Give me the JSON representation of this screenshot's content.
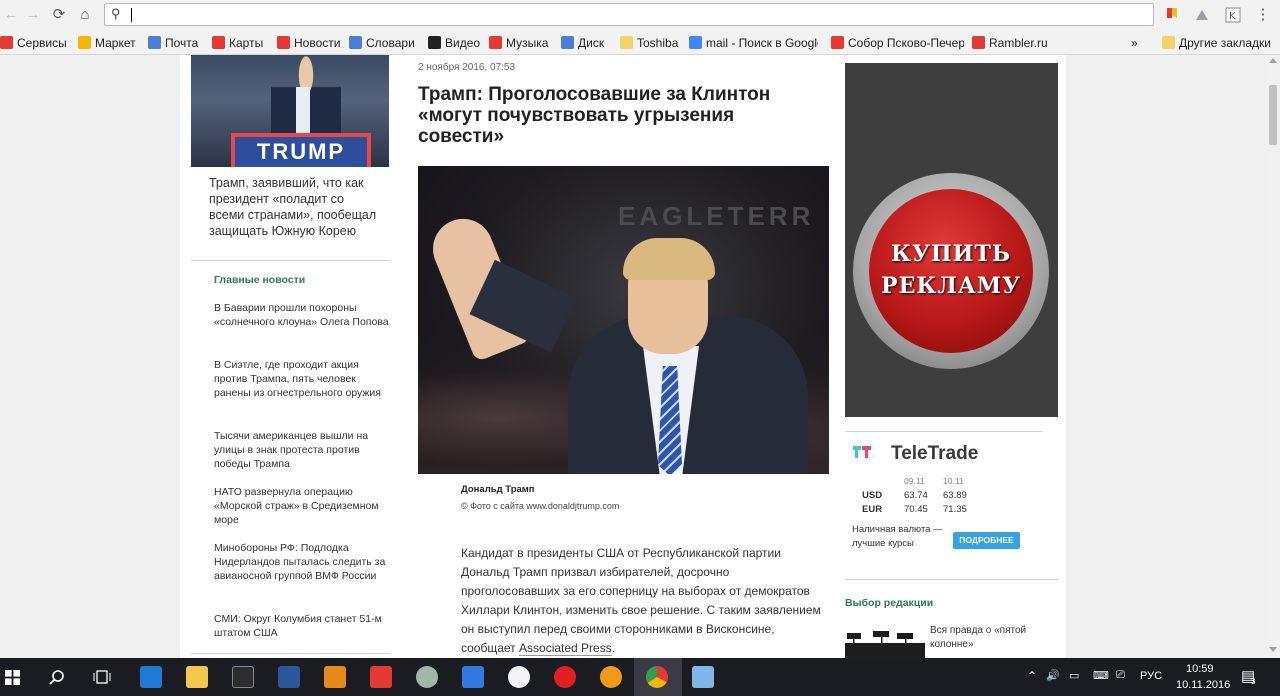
{
  "browser": {
    "omnibox_value": "",
    "bookmarks": [
      {
        "label": "Сервисы",
        "icon": "apps-grid-icon",
        "color": "#e53935"
      },
      {
        "label": "Маркет",
        "icon": "market-icon",
        "color": "#f2b705"
      },
      {
        "label": "Почта",
        "icon": "mail-page-icon",
        "color": "#4a7fd4"
      },
      {
        "label": "Карты",
        "icon": "map-pin-icon",
        "color": "#e53935"
      },
      {
        "label": "Новости",
        "icon": "news-icon",
        "color": "#e53935"
      },
      {
        "label": "Словари",
        "icon": "dictionary-icon",
        "color": "#4a7fd4"
      },
      {
        "label": "Видео",
        "icon": "video-play-icon",
        "color": "#222222"
      },
      {
        "label": "Музыка",
        "icon": "music-note-icon",
        "color": "#e53935"
      },
      {
        "label": "Диск",
        "icon": "disk-icon",
        "color": "#4a7fd4"
      },
      {
        "label": "Toshiba",
        "icon": "folder-icon",
        "color": "#f3d16b"
      },
      {
        "label": "mail - Поиск в Google",
        "icon": "google-icon",
        "color": "#4285f4"
      },
      {
        "label": "Собор Псково-Печер",
        "icon": "yandex-icon",
        "color": "#e53935"
      },
      {
        "label": "Rambler.ru",
        "icon": "yandex-icon",
        "color": "#e53935"
      }
    ],
    "more_bookmarks": "»",
    "other_bookmarks": "Другие закладки"
  },
  "left": {
    "lead_sign_text": "TRUMP",
    "lead_caption": "Трамп, заявивший, что как президент «поладит со всеми странами», пообещал защищать Южную Корею",
    "section_title": "Главные новости",
    "news": [
      "В Баварии прошли похороны «солнечного клоуна» Олега Попова",
      "В Сиэтле, где проходит акция против Трампа, пять человек ранены из огнестрельного оружия",
      "Тысячи американцев вышли на улицы в знак протеста против победы Трампа",
      "НАТО развернула операцию «Морской страж» в Средиземном море",
      "Минобороны РФ: Подлодка Нидерландов пыталась следить за авианосной группой ВМФ России",
      "СМИ: Округ Колумбия станет 51-м штатом США"
    ]
  },
  "article": {
    "date": "2 ноября 2016, 07:53",
    "title": "Трамп: Проголосовавшие за Клинтон «могут почувствовать угрызения совести»",
    "photo_backdrop": "EAGLETERR",
    "photo_caption": "Дональд Трамп",
    "photo_credit": "© Фото с сайта www.donaldjtrump.com",
    "body": "Кандидат в президенты США от Республиканской партии Дональд Трамп призвал избирателей, досрочно проголосовавших за его соперницу на выборах от демократов Хиллари Клинтон, изменить свое решение. С таким заявлением он выступил перед своими сторонниками в Висконсине, сообщает ",
    "body_link": "Associated Press",
    "body_end": "."
  },
  "right": {
    "ad_line1": "КУПИТЬ",
    "ad_line2": "РЕКЛАМУ",
    "teletrade": {
      "name": "TeleTrade",
      "date1": "09.11",
      "date2": "10.11",
      "rows": [
        {
          "cur": "USD",
          "v1": "63.74",
          "v2": "63.89"
        },
        {
          "cur": "EUR",
          "v1": "70.45",
          "v2": "71.35"
        }
      ],
      "cash_text": "Наличная валюта — лучшие курсы",
      "more_button": "ПОДРОБНЕЕ",
      "logo_colors": [
        "#3fc6d0",
        "#e8457d"
      ]
    },
    "editor_title": "Выбор редакции",
    "editor_item": "Вся правда о «пятой колонне»"
  },
  "taskbar": {
    "lang": "РУС",
    "time": "10:59",
    "date": "10.11.2016",
    "notifications": "3"
  },
  "colors": {
    "section_green": "#2e7d4f",
    "teletrade_button": "#36a2e0",
    "ad_red": "#b81818"
  }
}
